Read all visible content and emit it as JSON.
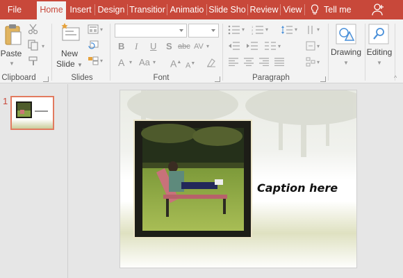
{
  "tabs": [
    {
      "label": "File",
      "active": false
    },
    {
      "label": "Home",
      "active": true
    },
    {
      "label": "Insert",
      "active": false
    },
    {
      "label": "Design",
      "active": false
    },
    {
      "label": "Transitior",
      "active": false
    },
    {
      "label": "Animatio",
      "active": false
    },
    {
      "label": "Slide Sho",
      "active": false
    },
    {
      "label": "Review",
      "active": false
    },
    {
      "label": "View",
      "active": false
    }
  ],
  "tell_me": "Tell me",
  "ribbon": {
    "clipboard": {
      "paste": "Paste",
      "group": "Clipboard"
    },
    "slides": {
      "new_slide_1": "New",
      "new_slide_2": "Slide",
      "group": "Slides"
    },
    "font": {
      "group": "Font",
      "font_name": "",
      "font_size": "",
      "bold": "B",
      "italic": "I",
      "underline": "U",
      "shadow": "S",
      "strike": "abc",
      "spacing": "AV",
      "color": "A",
      "case": "Aa",
      "grow": "A",
      "shrink": "A"
    },
    "paragraph": {
      "group": "Paragraph"
    },
    "drawing": {
      "label": "Drawing"
    },
    "editing": {
      "label": "Editing"
    }
  },
  "thumbnails": [
    {
      "number": "1"
    }
  ],
  "slide": {
    "caption": "Caption here"
  },
  "colors": {
    "accent": "#c8483a",
    "thumb_border": "#e27a5f"
  }
}
